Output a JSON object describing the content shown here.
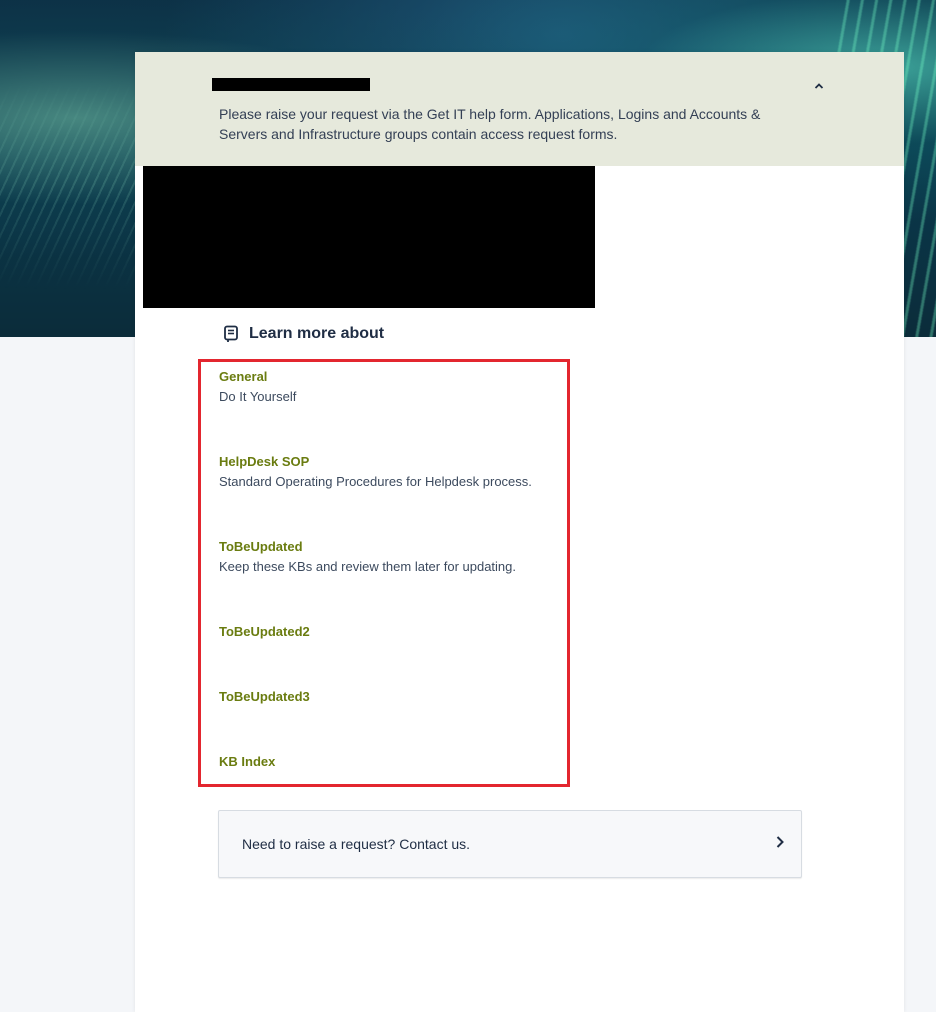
{
  "banner": {
    "text": "Please raise your request via the Get IT help form. Applications, Logins and Accounts & Servers and Infrastructure groups contain access request forms.",
    "collapse_icon": "chevron-up-icon"
  },
  "learn_more": {
    "icon": "book-icon",
    "title": "Learn more about"
  },
  "kb_items": [
    {
      "name": "General",
      "description": "Do It Yourself"
    },
    {
      "name": "HelpDesk SOP",
      "description": "Standard Operating Procedures for Helpdesk process."
    },
    {
      "name": "ToBeUpdated",
      "description": "Keep these KBs and review them later for updating."
    },
    {
      "name": "ToBeUpdated2",
      "description": ""
    },
    {
      "name": "ToBeUpdated3",
      "description": ""
    },
    {
      "name": "KB Index",
      "description": ""
    }
  ],
  "contact": {
    "text": "Need to raise a request? Contact us.",
    "icon": "chevron-right-icon"
  },
  "colors": {
    "banner_bg": "#e6e9dc",
    "kb_link": "#6a7c10",
    "highlight_border": "#e3262f"
  }
}
